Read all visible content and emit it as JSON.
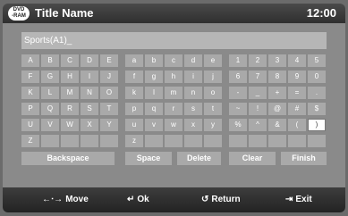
{
  "header": {
    "title": "Title Name",
    "time": "12:00",
    "icon": "dvd-ram-icon",
    "icon_top": "DVD",
    "icon_bottom": "-RAM"
  },
  "input": {
    "value": "Sports(A1)_"
  },
  "keyboard": {
    "rows": [
      [
        "A",
        "B",
        "C",
        "D",
        "E",
        "a",
        "b",
        "c",
        "d",
        "e",
        "1",
        "2",
        "3",
        "4",
        "5"
      ],
      [
        "F",
        "G",
        "H",
        "I",
        "J",
        "f",
        "g",
        "h",
        "i",
        "j",
        "6",
        "7",
        "8",
        "9",
        "0"
      ],
      [
        "K",
        "L",
        "M",
        "N",
        "O",
        "k",
        "l",
        "m",
        "n",
        "o",
        "-",
        "_",
        "+",
        "=",
        "."
      ],
      [
        "P",
        "Q",
        "R",
        "S",
        "T",
        "p",
        "q",
        "r",
        "s",
        "t",
        "~",
        "!",
        "@",
        "#",
        "$"
      ],
      [
        "U",
        "V",
        "W",
        "X",
        "Y",
        "u",
        "v",
        "w",
        "x",
        "y",
        "%",
        "^",
        "&",
        "(",
        ")"
      ],
      [
        "Z",
        "",
        "",
        "",
        "",
        "z",
        "",
        "",
        "",
        "",
        "",
        "",
        "",
        "",
        ""
      ]
    ],
    "selected": {
      "row": 4,
      "col": 14
    }
  },
  "functions": {
    "backspace": "Backspace",
    "space": "Space",
    "delete": "Delete",
    "clear": "Clear",
    "finish": "Finish"
  },
  "footer": {
    "move": {
      "icon": "move-arrows-icon",
      "label": "Move"
    },
    "ok": {
      "icon": "enter-icon",
      "label": "Ok"
    },
    "return": {
      "icon": "return-icon",
      "label": "Return"
    },
    "exit": {
      "icon": "exit-icon",
      "label": "Exit"
    }
  }
}
